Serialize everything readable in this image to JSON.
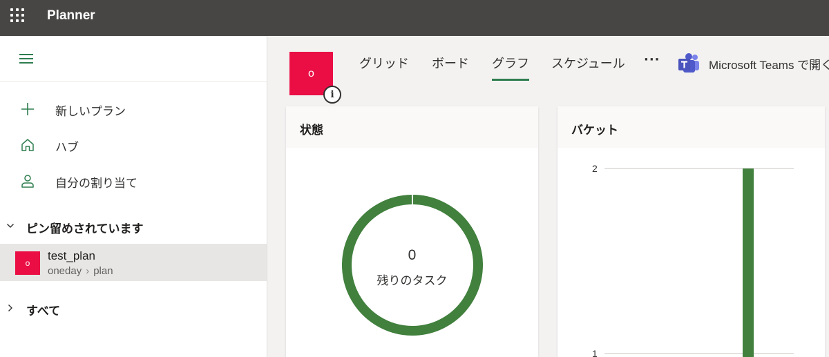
{
  "topbar": {
    "app_title": "Planner",
    "bg_color": "#484644"
  },
  "sidebar": {
    "nav_items": [
      {
        "label": "新しいプラン",
        "icon": "plus-icon"
      },
      {
        "label": "ハブ",
        "icon": "home-icon"
      },
      {
        "label": "自分の割り当て",
        "icon": "person-icon"
      }
    ],
    "pinned": {
      "header": "ピン留めされています",
      "expanded": true,
      "plans": [
        {
          "avatar": "o",
          "name": "test_plan",
          "group": "oneday",
          "plan": "plan"
        }
      ]
    },
    "all": {
      "header": "すべて",
      "expanded": false
    }
  },
  "plan_header": {
    "tile_letter": "o",
    "tile_color": "#ea0e45",
    "info_glyph": "i",
    "tabs": [
      {
        "label": "グリッド",
        "active": false
      },
      {
        "label": "ボード",
        "active": false
      },
      {
        "label": "グラフ",
        "active": true
      },
      {
        "label": "スケジュール",
        "active": false
      }
    ],
    "more_label": "···",
    "teams_label": "Microsoft Teams で開く"
  },
  "status_card": {
    "title": "状態",
    "remaining_count": "0",
    "remaining_label": "残りのタスク"
  },
  "bucket_card": {
    "title": "バケット"
  },
  "chart_data": [
    {
      "type": "pie",
      "title": "状態",
      "values": [
        1
      ],
      "colors": [
        "#41803d"
      ]
    },
    {
      "type": "bar",
      "title": "バケット",
      "categories": [
        ""
      ],
      "series": [
        {
          "values": [
            2
          ]
        }
      ],
      "y_ticks": [
        "2",
        "1"
      ],
      "ylim": [
        1,
        2
      ],
      "grid": true,
      "color": "#41803d"
    }
  ],
  "colors": {
    "accent": "#2e7d4f",
    "chart_green": "#41803d",
    "plan_red": "#ea0e45"
  }
}
